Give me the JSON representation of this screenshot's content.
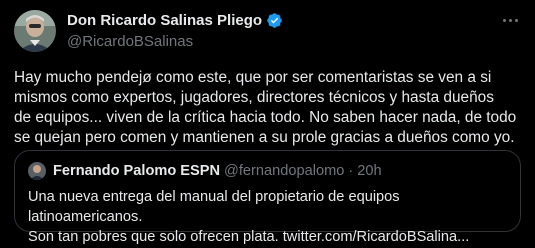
{
  "tweet": {
    "author_name": "Don Ricardo Salinas Pliego",
    "author_handle": "@RicardoBSalinas",
    "text": "Hay mucho pendejø como este, que por ser comentaristas se ven a si\nmismos como expertos, jugadores, directores técnicos y hasta dueños\nde equipos... viven de la crítica hacia todo. No saben hacer nada, de todo\nse quejan pero comen y mantienen a su prole gracias a dueños como yo."
  },
  "quoted_tweet": {
    "author_name": "Fernando Palomo ESPN",
    "author_handle": "@fernandopalomo",
    "separator": "·",
    "time": "20h",
    "text": "Una nueva entrega del manual del propietario de equipos latinoamericanos.\nSon tan pobres que solo ofrecen plata. twitter.com/RicardoBSalina..."
  },
  "colors": {
    "background": "#000000",
    "text": "#e7e9ea",
    "secondary": "#71767b",
    "verified": "#1d9bf0",
    "border": "#2f3336"
  },
  "icons": {
    "verified": "verified-badge-icon",
    "more": "more-options-icon"
  }
}
